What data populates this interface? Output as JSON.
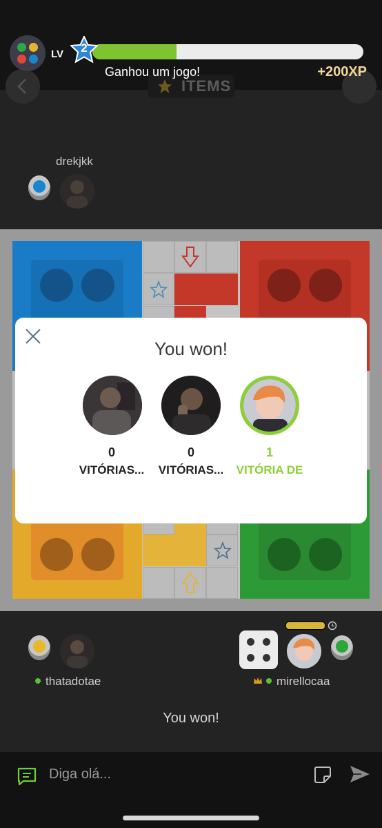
{
  "level": {
    "label": "LV",
    "number": "2",
    "xp_fraction": 0.31,
    "message": "Ganhou um jogo!",
    "xp_gain": "+200XP"
  },
  "header": {
    "items_label": "ITEMS"
  },
  "players": {
    "top_left": {
      "name": "drekjkk",
      "color": "#1a86d0"
    },
    "bottom_left": {
      "name": "thatadotae",
      "color": "#e9b826"
    },
    "bottom_right": {
      "name": "mirellocaa",
      "color": "#29a83a"
    }
  },
  "dialog": {
    "title": "You won!",
    "results": [
      {
        "count": "0",
        "label": "VITÓRIAS...",
        "highlight": false
      },
      {
        "count": "0",
        "label": "VITÓRIAS...",
        "highlight": false
      },
      {
        "count": "1",
        "label": "VITÓRIA DE",
        "highlight": true
      }
    ]
  },
  "status_text": "You won!",
  "chat": {
    "placeholder": "Diga olá..."
  },
  "colors": {
    "blue": "#1a7cc7",
    "red": "#c4382a",
    "yellow": "#e8b530",
    "green": "#2d9b35",
    "accent_green": "#8bd034",
    "xp_gold": "#f3d59a"
  }
}
